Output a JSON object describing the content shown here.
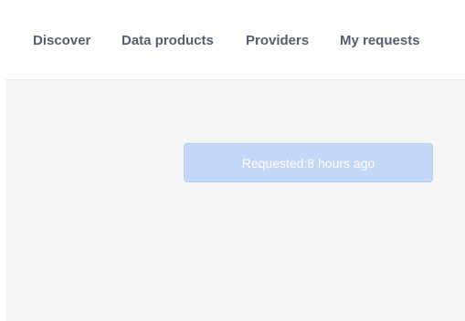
{
  "nav": {
    "items": [
      {
        "label": "Discover"
      },
      {
        "label": "Data products"
      },
      {
        "label": "Providers"
      },
      {
        "label": "My requests"
      }
    ]
  },
  "request_status": {
    "label": "Requested:",
    "time": "8 hours ago"
  },
  "colors": {
    "nav_text": "#555e70",
    "banner_bg": "#c3d7f8",
    "page_bg": "#f6f6f6"
  }
}
